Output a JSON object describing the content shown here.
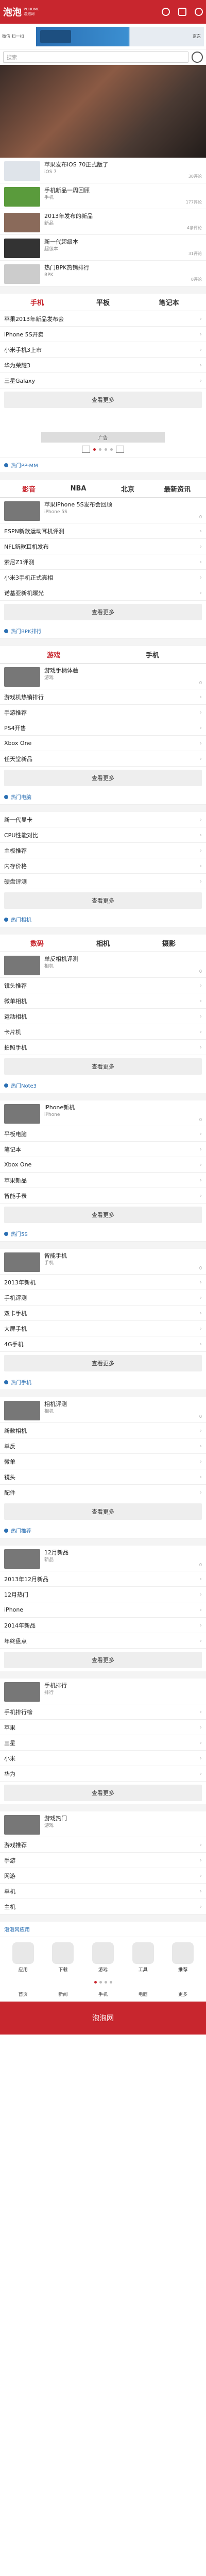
{
  "header": {
    "logo": "泡泡",
    "logo_sub1": "PCHOME",
    "logo_sub2": "泡泡网"
  },
  "adbar": {
    "left": "微信 扫一扫",
    "ad": "京东"
  },
  "search": {
    "placeholder": "搜索"
  },
  "hero": {
    "caption": ""
  },
  "news": [
    {
      "title": "苹果发布iOS 70正式版了",
      "desc": "iOS 7",
      "count": "30评论",
      "color": "#dfe4ea"
    },
    {
      "title": "手机新品一周回顾",
      "desc": "手机",
      "count": "177评论",
      "color": "#5a9b3c"
    },
    {
      "title": "2013年发布的新品",
      "desc": "新品",
      "count": "4条评论",
      "color": "#8a6a5a"
    },
    {
      "title": "新一代超级本",
      "desc": "超级本",
      "count": "31评论",
      "color": "#333"
    },
    {
      "title": "热门BPK热销排行",
      "desc": "BPK",
      "count": "0评论",
      "color": "#ccc"
    }
  ],
  "tab_block1": {
    "tabs": [
      "手机",
      "平板",
      "笔记本"
    ],
    "lines": [
      "苹果2013年新品发布会",
      "iPhone 5S开卖",
      "小米手机3上市",
      "华为荣耀3",
      "三星Galaxy"
    ],
    "more": "查看更多"
  },
  "adblock": {
    "cap": "广告"
  },
  "hot1": {
    "label": "热门PP-MM"
  },
  "tab_block2": {
    "tabs": [
      "影音",
      "NBA",
      "北京",
      "最新资讯"
    ],
    "feature_title": "苹果iPhone 5S发布会回顾",
    "feature_desc": "iPhone 5S",
    "feature_count": "0",
    "lines": [
      "ESPN新款运动耳机评测",
      "NFL新款耳机发布",
      "索尼Z1评测",
      "小米3手机正式亮相",
      "诺基亚新机曝光"
    ],
    "more": "查看更多"
  },
  "hot2": {
    "label": "热门BPK排行"
  },
  "tab_block3": {
    "tabs": [
      "游戏",
      "手机"
    ],
    "feature_title": "游戏手柄体验",
    "feature_desc": "游戏",
    "feature_count": "0",
    "lines": [
      "游戏机热销排行",
      "手游推荐",
      "PS4开售",
      "Xbox One",
      "任天堂新品"
    ],
    "more": "查看更多"
  },
  "hot3": {
    "label": "热门电脑"
  },
  "tab_block4": {
    "lines": [
      "新一代显卡",
      "CPU性能对比",
      "主板推荐",
      "内存价格",
      "硬盘评测"
    ],
    "more": "查看更多"
  },
  "hot4": {
    "label": "热门相机"
  },
  "tab_block5": {
    "tabs": [
      "数码",
      "相机",
      "摄影"
    ],
    "feature_title": "单反相机评测",
    "feature_desc": "相机",
    "feature_count": "0",
    "lines": [
      "镜头推荐",
      "微单相机",
      "运动相机",
      "卡片机",
      "拍照手机"
    ],
    "more": "查看更多"
  },
  "hot5": {
    "label": "热门Note3"
  },
  "tab_block6": {
    "feature_title": "iPhone新机",
    "feature_desc": "iPhone",
    "feature_count": "0",
    "lines": [
      "平板电脑",
      "笔记本",
      "Xbox One",
      "苹果新品",
      "智能手表"
    ],
    "more": "查看更多"
  },
  "hot6": {
    "label": "热门5S"
  },
  "tab_block7": {
    "feature_title": "智能手机",
    "feature_desc": "手机",
    "feature_count": "0",
    "lines": [
      "2013年新机",
      "手机评测",
      "双卡手机",
      "大屏手机",
      "4G手机"
    ],
    "more": "查看更多"
  },
  "hot7": {
    "label": "热门手机"
  },
  "tab_block8": {
    "feature_title": "相机评测",
    "feature_desc": "相机",
    "feature_count": "0",
    "lines": [
      "新款相机",
      "单反",
      "微单",
      "镜头",
      "配件"
    ],
    "more": "查看更多"
  },
  "hot8": {
    "label": "热门推荐"
  },
  "tab_block9": {
    "feature_title": "12月新品",
    "feature_desc": "新品",
    "feature_count": "0",
    "lines": [
      "2013年12月新品",
      "12月热门",
      "iPhone",
      "2014年新品",
      "年终盘点"
    ],
    "more": "查看更多"
  },
  "tab_block10": {
    "feature_title": "手机排行",
    "feature_desc": "排行",
    "lines": [
      "手机排行榜",
      "苹果",
      "三星",
      "小米",
      "华为"
    ],
    "more": "查看更多"
  },
  "tab_block11": {
    "feature_title": "游戏热门",
    "feature_desc": "游戏",
    "lines": [
      "游戏推荐",
      "手游",
      "网游",
      "单机",
      "主机"
    ]
  },
  "apps": {
    "title": "泡泡网应用",
    "items": [
      "应用",
      "下载",
      "游戏",
      "工具",
      "推荐"
    ]
  },
  "foot": {
    "links": [
      "首页",
      "新闻",
      "手机",
      "电脑",
      "更多"
    ],
    "bar": "泡泡网"
  }
}
